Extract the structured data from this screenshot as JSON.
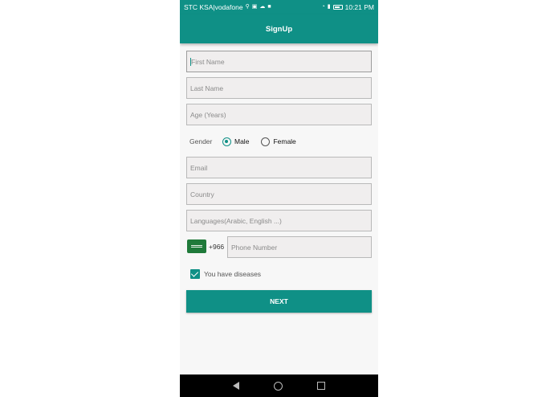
{
  "status_bar": {
    "carrier": "STC KSA|vodafone",
    "time": "10:21 PM"
  },
  "app_bar": {
    "title": "SignUp"
  },
  "form": {
    "first_name_placeholder": "First Name",
    "last_name_placeholder": "Last Name",
    "age_placeholder": "Age (Years)",
    "gender_label": "Gender",
    "gender_options": [
      "Male",
      "Female"
    ],
    "gender_selected": "Male",
    "email_placeholder": "Email",
    "country_placeholder": "Country",
    "languages_placeholder": "Languages(Arabic, English ...)",
    "dial_code": "+966",
    "phone_placeholder": "Phone Number",
    "diseases_label": "You have diseases",
    "diseases_checked": true,
    "next_label": "NEXT"
  },
  "colors": {
    "primary": "#0f9086",
    "background": "#f7f7f7",
    "field_background": "#f0eeee"
  }
}
